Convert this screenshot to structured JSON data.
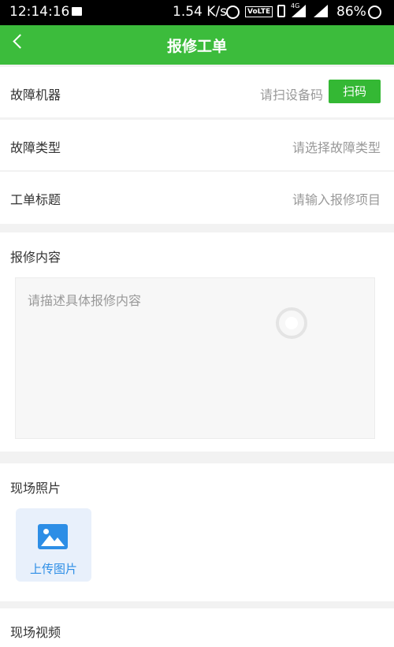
{
  "status": {
    "time": "12:14:16",
    "speed": "1.54 K/s",
    "volte": "VoLTE",
    "network": "4G",
    "battery": "86%"
  },
  "header": {
    "title": "报修工单"
  },
  "form": {
    "machine": {
      "label": "故障机器",
      "placeholder": "请扫设备码",
      "button": "扫码"
    },
    "type": {
      "label": "故障类型",
      "placeholder": "请选择故障类型"
    },
    "title": {
      "label": "工单标题",
      "placeholder": "请输入报修项目"
    },
    "content": {
      "label": "报修内容",
      "placeholder": "请描述具体报修内容"
    },
    "photos": {
      "label": "现场照片",
      "upload_label": "上传图片"
    },
    "video": {
      "label": "现场视频"
    }
  },
  "icons": {
    "back": "chevron-left-icon",
    "upload": "image-icon",
    "loading": "loading-spinner-icon"
  },
  "colors": {
    "header_bg": "#3cbc3c",
    "button_bg": "#34b834",
    "upload_accent": "#2d8ee6"
  }
}
